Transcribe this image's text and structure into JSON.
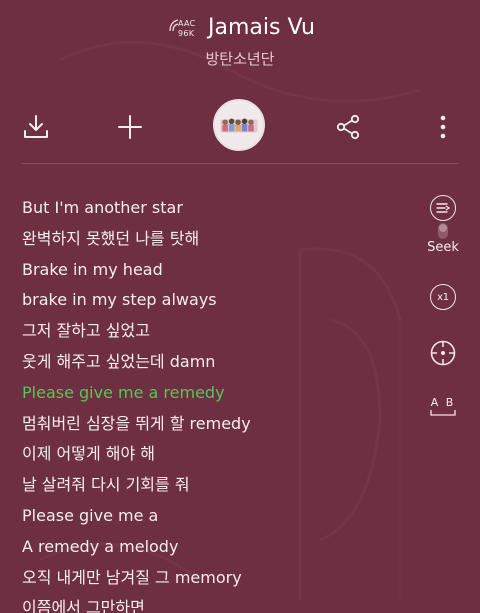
{
  "header": {
    "codec_format": "AAC",
    "codec_bitrate": "96K",
    "title": "Jamais Vu",
    "artist": "방탄소년단"
  },
  "toolbar": {
    "download_icon": "download-icon",
    "add_icon": "plus-icon",
    "album_art": "album-art-thumbnail",
    "share_icon": "share-icon",
    "more_icon": "more-vertical-icon"
  },
  "lyrics": {
    "lines": [
      "But I'm another star",
      "완벽하지 못했던 나를 탓해",
      "Brake in my head",
      "brake in my step always",
      "그저 잘하고 싶었고",
      "웃게 해주고 싶었는데 damn",
      "Please give me a remedy",
      "멈춰버린 심장을 뛰게 할 remedy",
      "이제 어떻게 해야 해",
      "날 살려줘 다시 기회를 줘",
      "Please give me a",
      "A remedy a melody",
      "오직 내게만 남겨질 그 memory",
      "이쯤에서 그만하면"
    ],
    "active_index": 6,
    "active_color": "#57c55a"
  },
  "side_controls": {
    "seek_label": "Seek",
    "speed_label": "x1",
    "ab_label": "A B"
  },
  "colors": {
    "background": "#6e2f42",
    "accent": "#57c55a"
  }
}
